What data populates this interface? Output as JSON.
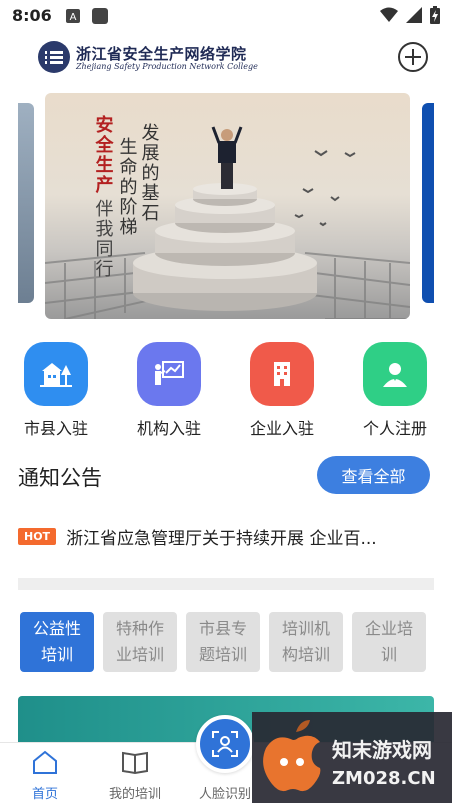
{
  "status_bar": {
    "time": "8:06"
  },
  "header": {
    "logo_cn": "浙江省安全生产网络学院",
    "logo_en": "Zhejiang Safety Production Network College"
  },
  "banner": {
    "slogan_left": [
      "安全生产",
      "伴我同行"
    ],
    "slogan_right_col1": "发展的基石",
    "slogan_right_col2": "生命的阶梯"
  },
  "quick_entries": [
    {
      "label": "市县入驻",
      "icon": "city-building-icon",
      "color": "#2f8ef0"
    },
    {
      "label": "机构入驻",
      "icon": "instructor-board-icon",
      "color": "#6b78ee"
    },
    {
      "label": "企业入驻",
      "icon": "office-building-icon",
      "color": "#f05a4a"
    },
    {
      "label": "个人注册",
      "icon": "person-icon",
      "color": "#2fcf86"
    }
  ],
  "notice": {
    "title": "通知公告",
    "view_all": "查看全部",
    "hot_badge": "HOT",
    "item": "浙江省应急管理厅关于持续开展 企业百..."
  },
  "category_tabs": [
    {
      "label": "公益性培训",
      "active": true
    },
    {
      "label": "特种作业培训",
      "active": false
    },
    {
      "label": "市县专题培训",
      "active": false
    },
    {
      "label": "培训机构培训",
      "active": false
    },
    {
      "label": "企业培训",
      "active": false
    }
  ],
  "bottom_nav": {
    "home": "首页",
    "my_training": "我的培训",
    "face_recognition": "人脸识别"
  },
  "watermark": {
    "line1": "知末游戏网",
    "line2": "ZM028.CN"
  },
  "colors": {
    "accent": "#2f73d8",
    "hot": "#f46a2e",
    "tab_inactive": "#e0e0e0"
  }
}
